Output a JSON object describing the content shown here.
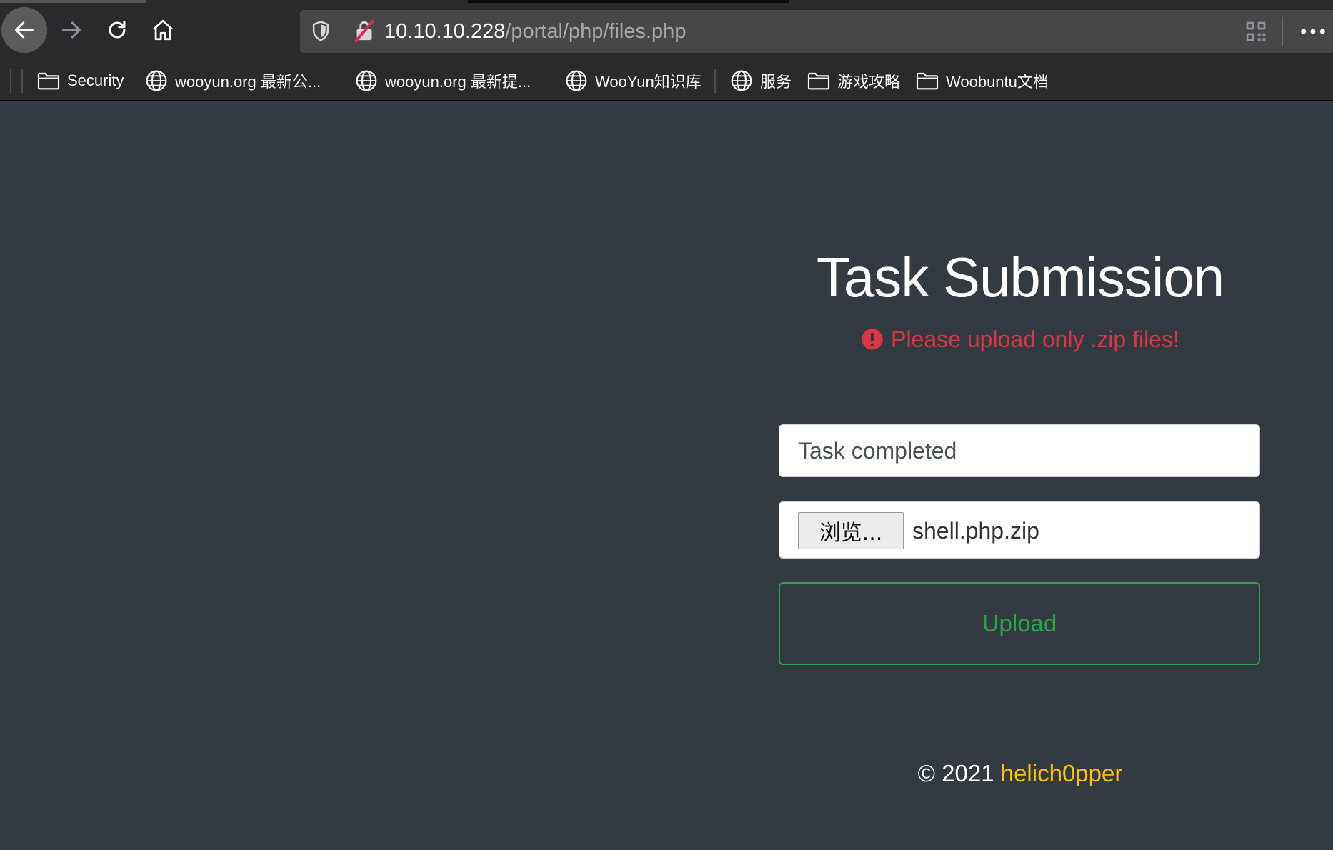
{
  "browser": {
    "url_host": "10.10.10.228",
    "url_path": "/portal/php/files.php",
    "bookmarks": [
      {
        "label": "Security",
        "icon": "folder-icon"
      },
      {
        "label": "wooyun.org 最新公...",
        "icon": "globe-icon"
      },
      {
        "label": "wooyun.org 最新提...",
        "icon": "globe-icon"
      },
      {
        "label": "WooYun知识库",
        "icon": "globe-icon"
      },
      {
        "label": "服务",
        "icon": "globe-icon"
      },
      {
        "label": "游戏攻略",
        "icon": "folder-icon"
      },
      {
        "label": "Woobuntu文档",
        "icon": "folder-icon"
      }
    ]
  },
  "page": {
    "title": "Task Submission",
    "alert": "Please upload only .zip files!",
    "task_input_value": "Task completed",
    "file": {
      "browse_label": "浏览...",
      "file_name": "shell.php.zip"
    },
    "upload_label": "Upload",
    "footer": {
      "copyright": "© 2021",
      "author": "helich0pper"
    }
  },
  "colors": {
    "background": "#343a41",
    "alert": "#dc3545",
    "success": "#28a745",
    "author": "#ffc107"
  }
}
